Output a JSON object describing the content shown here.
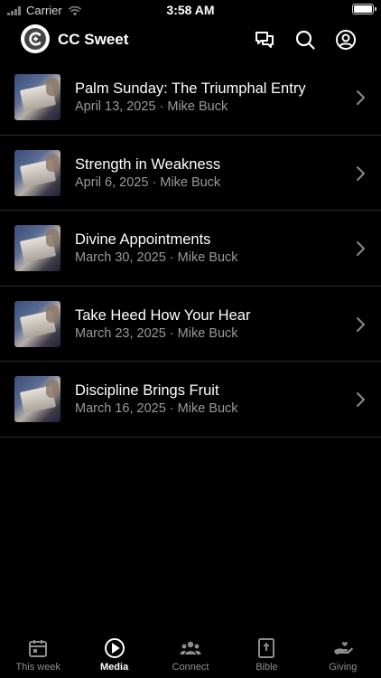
{
  "status_bar": {
    "carrier": "Carrier",
    "time": "3:58 AM"
  },
  "header": {
    "title": "CC Sweet"
  },
  "sermons": [
    {
      "title": "Palm Sunday: The Triumphal Entry",
      "subtitle": "April 13, 2025 · Mike Buck"
    },
    {
      "title": "Strength in Weakness",
      "subtitle": "April 6, 2025 · Mike Buck"
    },
    {
      "title": "Divine Appointments",
      "subtitle": "March 30, 2025 · Mike Buck"
    },
    {
      "title": "Take Heed How Your Hear",
      "subtitle": "March 23, 2025 · Mike Buck"
    },
    {
      "title": "Discipline Brings Fruit",
      "subtitle": "March 16, 2025 · Mike Buck"
    }
  ],
  "tabs": [
    {
      "label": "This week",
      "icon": "calendar-icon",
      "active": false
    },
    {
      "label": "Media",
      "icon": "play-circle-icon",
      "active": true
    },
    {
      "label": "Connect",
      "icon": "people-icon",
      "active": false
    },
    {
      "label": "Bible",
      "icon": "bible-icon",
      "active": false
    },
    {
      "label": "Giving",
      "icon": "giving-hand-icon",
      "active": false
    }
  ],
  "colors": {
    "background": "#000000",
    "text": "#ffffff",
    "secondary_text": "#9a9a9a",
    "separator": "#2b2b2b",
    "inactive_tab": "#8e8e8e"
  }
}
